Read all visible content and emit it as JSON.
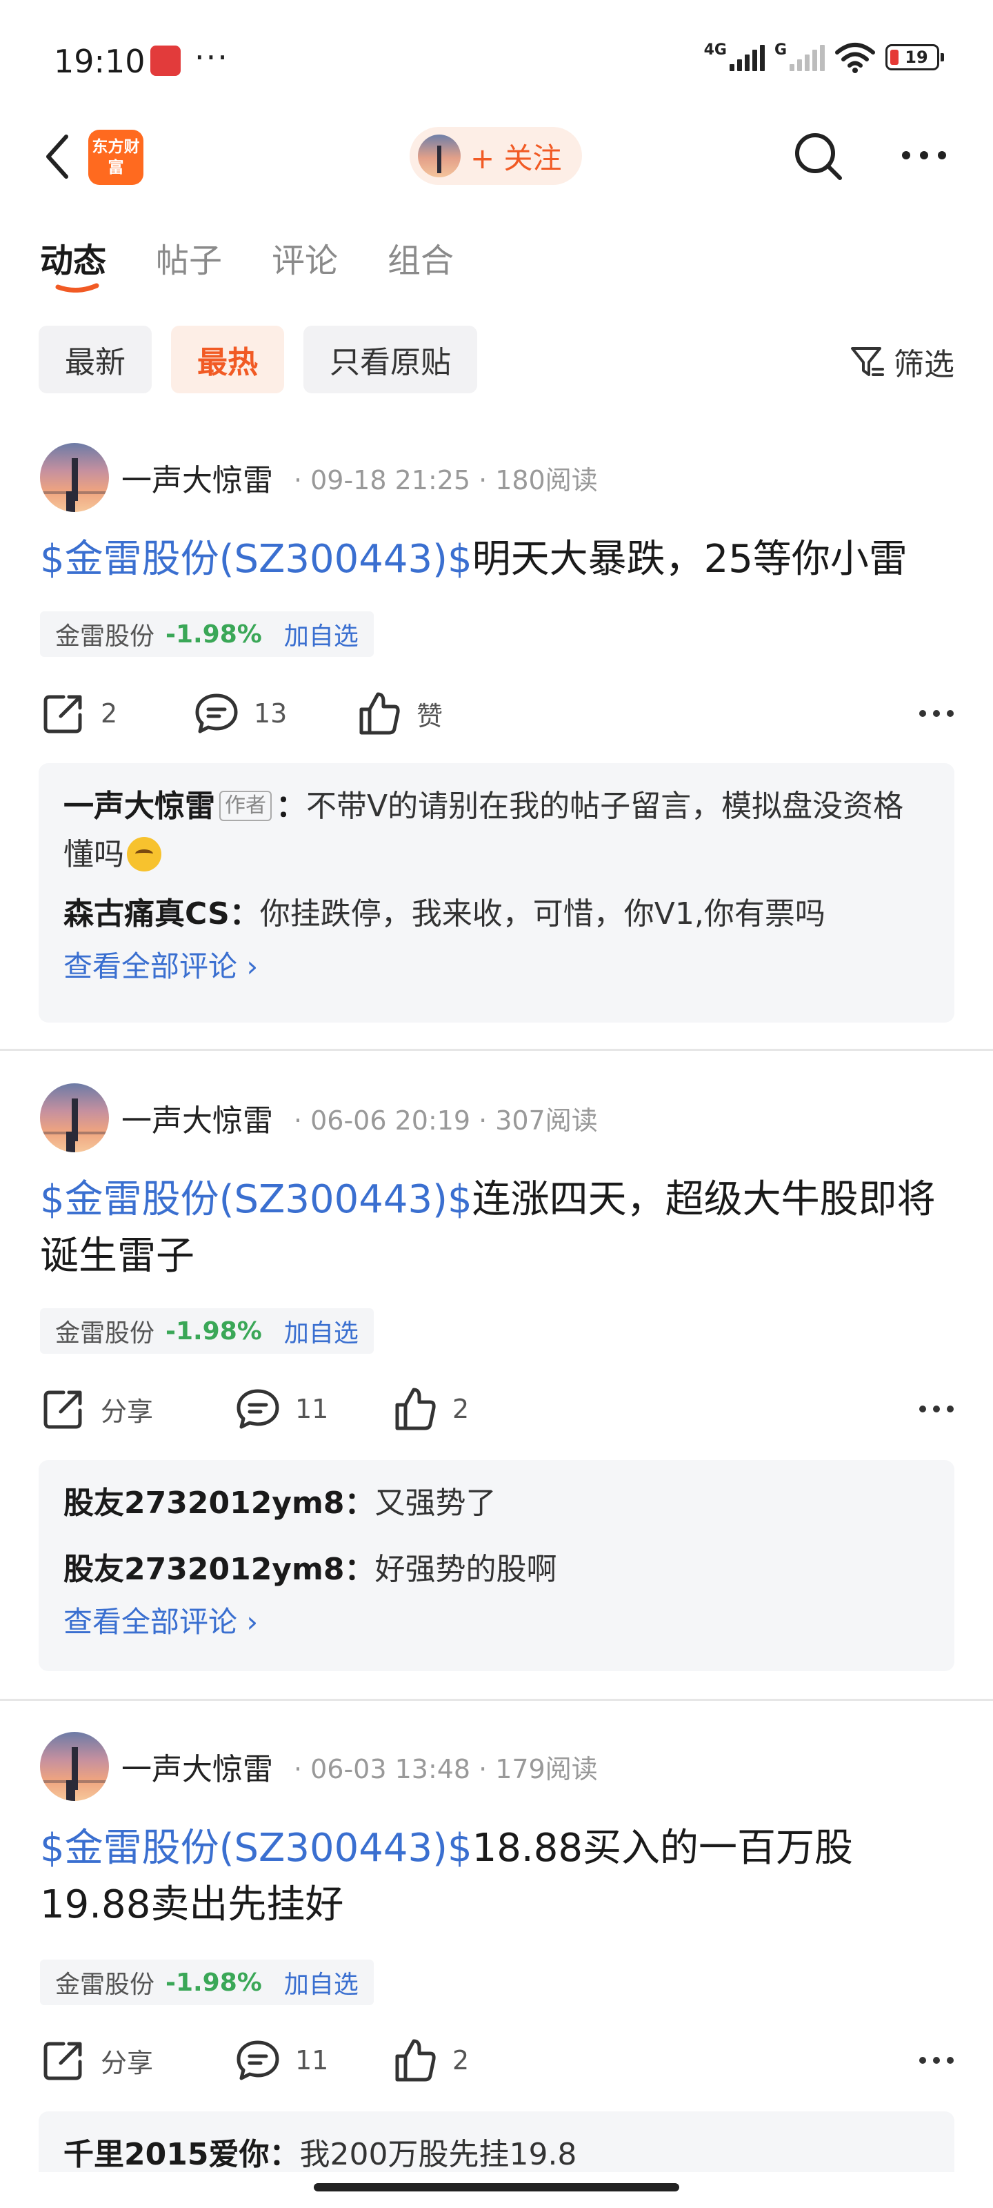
{
  "status_bar": {
    "time": "19:10",
    "dots": "···",
    "signal1_tag": "4G",
    "signal2_tag": "G",
    "battery": "19"
  },
  "header": {
    "logo_text": "东方财富",
    "follow_label": "+ 关注"
  },
  "tabs": [
    {
      "label": "动态",
      "active": true
    },
    {
      "label": "帖子",
      "active": false
    },
    {
      "label": "评论",
      "active": false
    },
    {
      "label": "组合",
      "active": false
    }
  ],
  "filters": {
    "chips": [
      {
        "label": "最新",
        "active": false
      },
      {
        "label": "最热",
        "active": true
      },
      {
        "label": "只看原贴",
        "active": false
      }
    ],
    "filter_label": "筛选"
  },
  "colors": {
    "accent": "#f15a24",
    "link": "#3a6fd0",
    "down_green": "#3aa757"
  },
  "posts": [
    {
      "author": "一声大惊雷",
      "date": "09-18 21:25",
      "reads": "180阅读",
      "stock_link": "$金雷股份(SZ300443)$",
      "title_rest": "明天大暴跌，25等你小雷",
      "tag_name": "金雷股份",
      "tag_change": "-1.98%",
      "tag_add": "加自选",
      "share": "2",
      "comments_count": "13",
      "likes": "赞",
      "comments": [
        {
          "name": "一声大惊雷",
          "badge": "作者",
          "sep": "：",
          "text": "不带V的请别在我的帖子留言，模拟盘没资格懂吗"
        },
        {
          "name": "森古痛真CS",
          "sep": "：",
          "text": "你挂跌停，我来收，可惜，你V1,你有票吗"
        }
      ],
      "view_all": "查看全部评论 ›"
    },
    {
      "author": "一声大惊雷",
      "date": "06-06 20:19",
      "reads": "307阅读",
      "stock_link": "$金雷股份(SZ300443)$",
      "title_rest": "连涨四天，超级大牛股即将诞生雷子",
      "tag_name": "金雷股份",
      "tag_change": "-1.98%",
      "tag_add": "加自选",
      "share": "分享",
      "comments_count": "11",
      "likes": "2",
      "comments": [
        {
          "name": "股友2732012ym8",
          "sep": "：",
          "text": "又强势了"
        },
        {
          "name": "股友2732012ym8",
          "sep": "：",
          "text": "好强势的股啊"
        }
      ],
      "view_all": "查看全部评论 ›"
    },
    {
      "author": "一声大惊雷",
      "date": "06-03 13:48",
      "reads": "179阅读",
      "stock_link": "$金雷股份(SZ300443)$",
      "title_rest": "18.88买入的一百万股19.88卖出先挂好",
      "tag_name": "金雷股份",
      "tag_change": "-1.98%",
      "tag_add": "加自选",
      "share": "分享",
      "comments_count": "11",
      "likes": "2",
      "comments": [
        {
          "name": "千里2015爱你",
          "sep": "：",
          "text": "我200万股先挂19.8"
        }
      ]
    }
  ]
}
